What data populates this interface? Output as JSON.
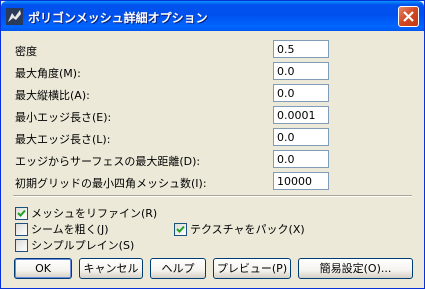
{
  "window": {
    "title": "ポリゴンメッシュ詳細オプション"
  },
  "fields": [
    {
      "label": "密度",
      "value": "0.5"
    },
    {
      "label": "最大角度(M):",
      "value": "0.0"
    },
    {
      "label": "最大縦横比(A):",
      "value": "0.0"
    },
    {
      "label": "最小エッジ長さ(E):",
      "value": "0.0001"
    },
    {
      "label": "最大エッジ長さ(L):",
      "value": "0.0"
    },
    {
      "label": "エッジからサーフェスの最大距離(D):",
      "value": "0.0"
    },
    {
      "label": "初期グリッドの最小四角メッシュ数(I):",
      "value": "10000"
    }
  ],
  "options": [
    {
      "label": "メッシュをリファイン(R)",
      "checked": true
    },
    {
      "label": "シームを粗く(J)",
      "checked": false
    },
    {
      "label": "テクスチャをパック(X)",
      "checked": true
    },
    {
      "label": "シンプルプレイン(S)",
      "checked": false
    }
  ],
  "buttons": {
    "ok": "OK",
    "cancel": "キャンセル",
    "help": "ヘルプ",
    "preview": "プレビュー(P)",
    "simple": "簡易設定(O)..."
  },
  "colors": {
    "titlebar": "#0054e3",
    "dialog_bg": "#ece9d8",
    "check": "#21a121",
    "close": "#d24722"
  }
}
